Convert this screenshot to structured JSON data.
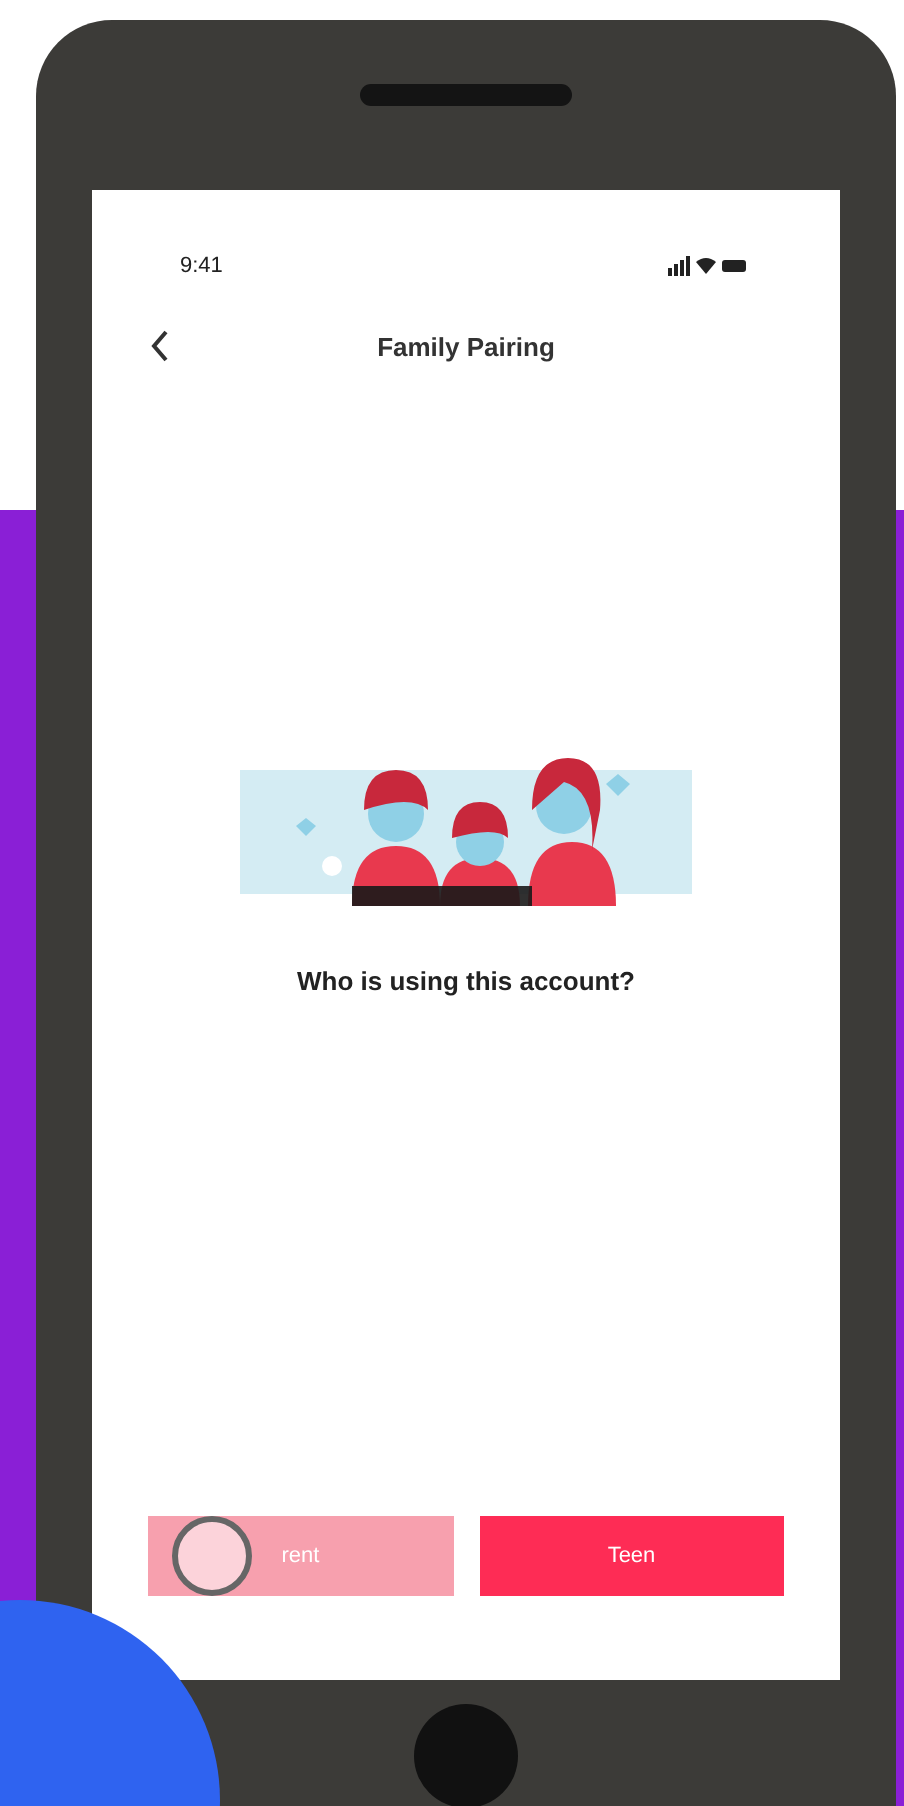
{
  "status_bar": {
    "time": "9:41"
  },
  "header": {
    "title": "Family Pairing"
  },
  "prompt": "Who is using this account?",
  "buttons": [
    {
      "label": "rent",
      "pressed": true
    },
    {
      "label": "Teen",
      "pressed": false
    }
  ]
}
